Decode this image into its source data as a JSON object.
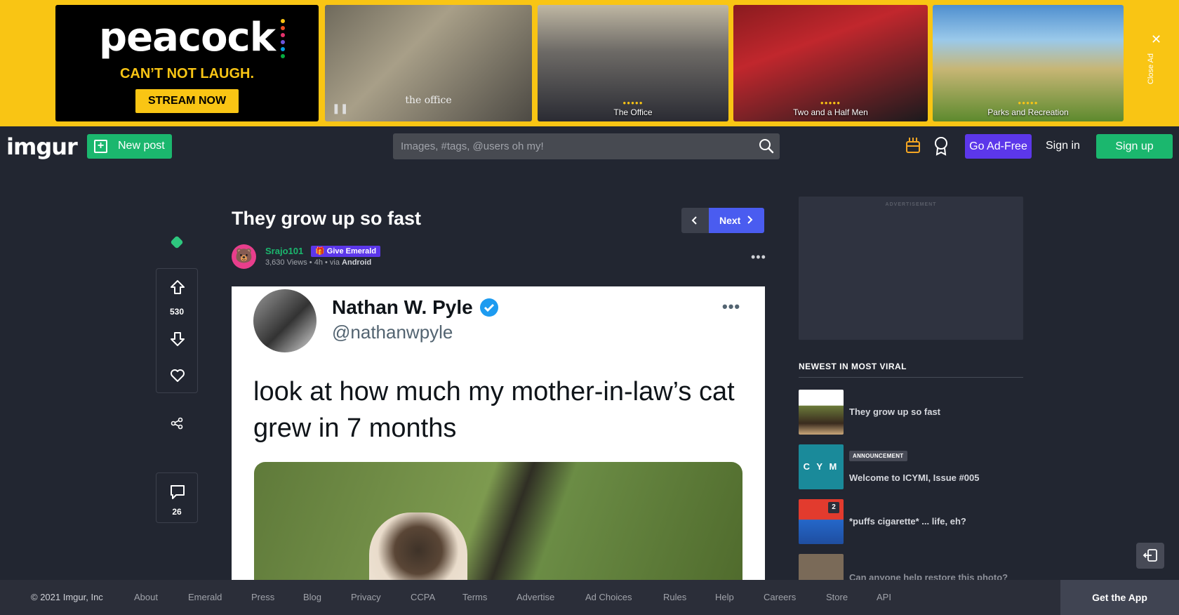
{
  "ad": {
    "peacock_logo": "peacock",
    "peacock_tagline": "CAN’T NOT LAUGH.",
    "peacock_button": "STREAM NOW",
    "tile1_title": "the office",
    "tile2_caption": "The Office",
    "tile3_caption": "Two and a Half Men",
    "tile4_caption": "Parks and Recreation",
    "stars": "●●●●●",
    "close_label": "Close Ad",
    "brand_color": "#f9c514"
  },
  "nav": {
    "brand": "imgur",
    "new_post": "New post",
    "search_placeholder": "Images, #tags, @users oh my!",
    "go_ad_free": "Go Ad-Free",
    "sign_in": "Sign in",
    "sign_up": "Sign up",
    "accent_green": "#1bb76e",
    "accent_purple": "#5c37ea"
  },
  "post": {
    "title": "They grow up so fast",
    "next_label": "Next",
    "username": "Srajo101",
    "give_emerald": "Give Emerald",
    "views": "3,630 Views",
    "age": "4h",
    "via_prefix": "via",
    "via_source": "Android",
    "score": "530",
    "comments": "26"
  },
  "tweet": {
    "name": "Nathan W. Pyle",
    "handle": "@nathanwpyle",
    "text": "look at how much my mother-in-law’s cat grew in 7 months"
  },
  "sidebar": {
    "ad_label": "ADVERTISEMENT",
    "section_title": "NEWEST IN MOST VIRAL",
    "items": [
      {
        "title": "They grow up so fast"
      },
      {
        "badge": "ANNOUNCEMENT",
        "title": "Welcome to ICYMI, Issue #005",
        "thumb_text": "C Y M"
      },
      {
        "title": "*puffs cigarette* ... life, eh?",
        "count": "2"
      },
      {
        "title": "Can anyone help restore this photo?"
      }
    ]
  },
  "footer": {
    "copyright": "© 2021 Imgur, Inc",
    "links": [
      "About",
      "Emerald",
      "Press",
      "Blog",
      "Privacy",
      "CCPA",
      "Terms",
      "Advertise",
      "Ad Choices",
      "Rules",
      "Help",
      "Careers",
      "Store",
      "API"
    ],
    "get_app": "Get the App"
  }
}
